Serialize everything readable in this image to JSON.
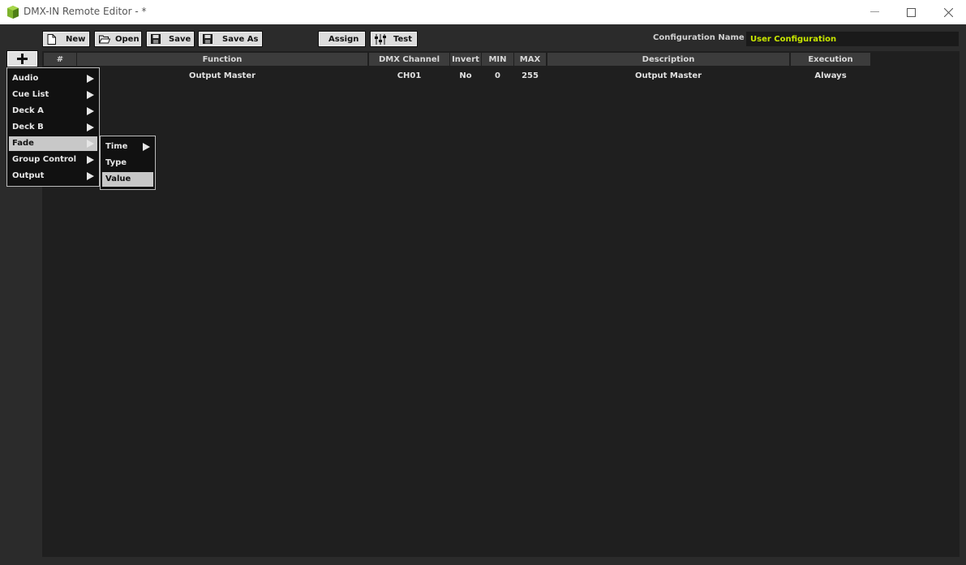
{
  "window": {
    "title": "DMX-IN Remote Editor - *",
    "controls": {
      "minimize": "minimize-icon",
      "maximize": "maximize-icon",
      "close": "close-icon"
    }
  },
  "toolbar": {
    "new_label": "New",
    "open_label": "Open",
    "save_label": "Save",
    "save_as_label": "Save As",
    "assign_label": "Assign",
    "test_label": "Test",
    "config_label": "Configuration Name :",
    "config_value": "User Configuration"
  },
  "add_button_icon": "plus-icon",
  "table": {
    "headers": {
      "num": "#",
      "function": "Function",
      "dmx_channel": "DMX Channel",
      "invert": "Invert",
      "min": "MIN",
      "max": "MAX",
      "description": "Description",
      "execution": "Execution"
    },
    "rows": [
      {
        "function": "Output Master",
        "dmx_channel": "CH01",
        "invert": "No",
        "min": "0",
        "max": "255",
        "description": "Output Master",
        "execution": "Always"
      }
    ]
  },
  "menu": {
    "items": [
      "Audio",
      "Cue List",
      "Deck A",
      "Deck B",
      "Fade",
      "Group Control",
      "Output"
    ],
    "active": "Fade"
  },
  "submenu": {
    "items": [
      "Time",
      "Type",
      "Value"
    ],
    "active": "Value"
  },
  "colors": {
    "background": "#2b2b2b",
    "panel": "#1f1f1f",
    "accent": "#c8e600"
  }
}
